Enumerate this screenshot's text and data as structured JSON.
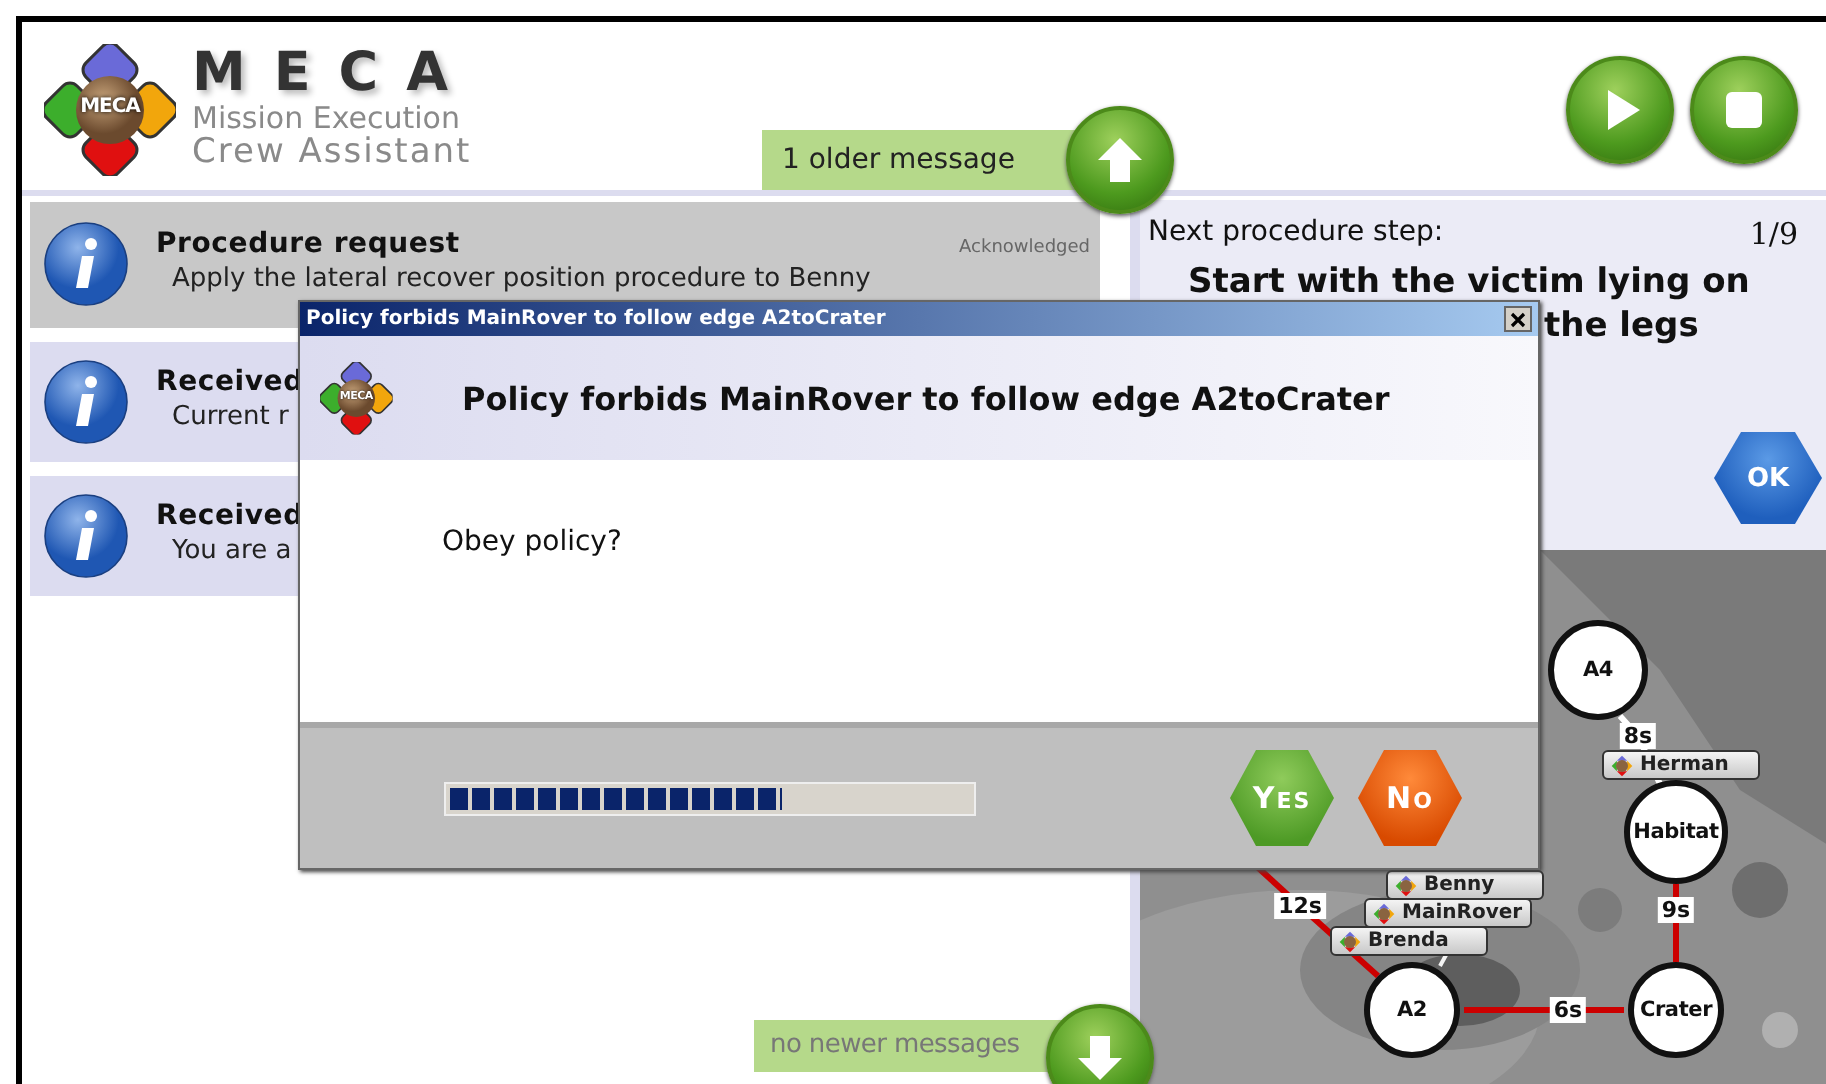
{
  "header": {
    "logo_badge": "MECA",
    "title": "MECA",
    "subtitle": [
      "Mission Execution",
      "Crew Assistant"
    ]
  },
  "older_messages": {
    "label": "1 older message"
  },
  "newer_messages": {
    "label": "no newer messages"
  },
  "messages": [
    {
      "title": "Procedure request",
      "text": "Apply the lateral recover position procedure to Benny",
      "status": "Acknowledged",
      "acknowledged": true
    },
    {
      "title": "Received",
      "text": "Current r",
      "acknowledged": false
    },
    {
      "title": "Received",
      "text": "You are a",
      "acknowledged": false
    }
  ],
  "procedure": {
    "heading": "Next procedure step:",
    "counter": "1/9",
    "step_lines": [
      "Start with the victim lying on",
      "the legs"
    ],
    "ok_button": "OK"
  },
  "map": {
    "nodes": [
      {
        "label": "A4"
      },
      {
        "label": "Habitat"
      },
      {
        "label": "Crater"
      },
      {
        "label": "A2"
      }
    ],
    "edges": [
      {
        "label": "12s",
        "color": "#cc0000"
      },
      {
        "label": "6s",
        "color": "#cc0000"
      },
      {
        "label": "9s",
        "color": "#cc0000"
      },
      {
        "label": "8s",
        "color": "#ffffff"
      }
    ],
    "tags": [
      {
        "name": "Herman"
      },
      {
        "name": "Benny"
      },
      {
        "name": "MainRover"
      },
      {
        "name": "Brenda"
      }
    ]
  },
  "dialog": {
    "title": "Policy forbids MainRover to follow edge A2toCrater",
    "logo_badge": "MECA",
    "heading": "Policy forbids MainRover to follow edge A2toCrater",
    "question": "Obey policy?",
    "progress": {
      "level": 0.64
    },
    "buttons": [
      {
        "label": "Yes",
        "kind": "yes"
      },
      {
        "label": "No",
        "kind": "no"
      }
    ]
  }
}
